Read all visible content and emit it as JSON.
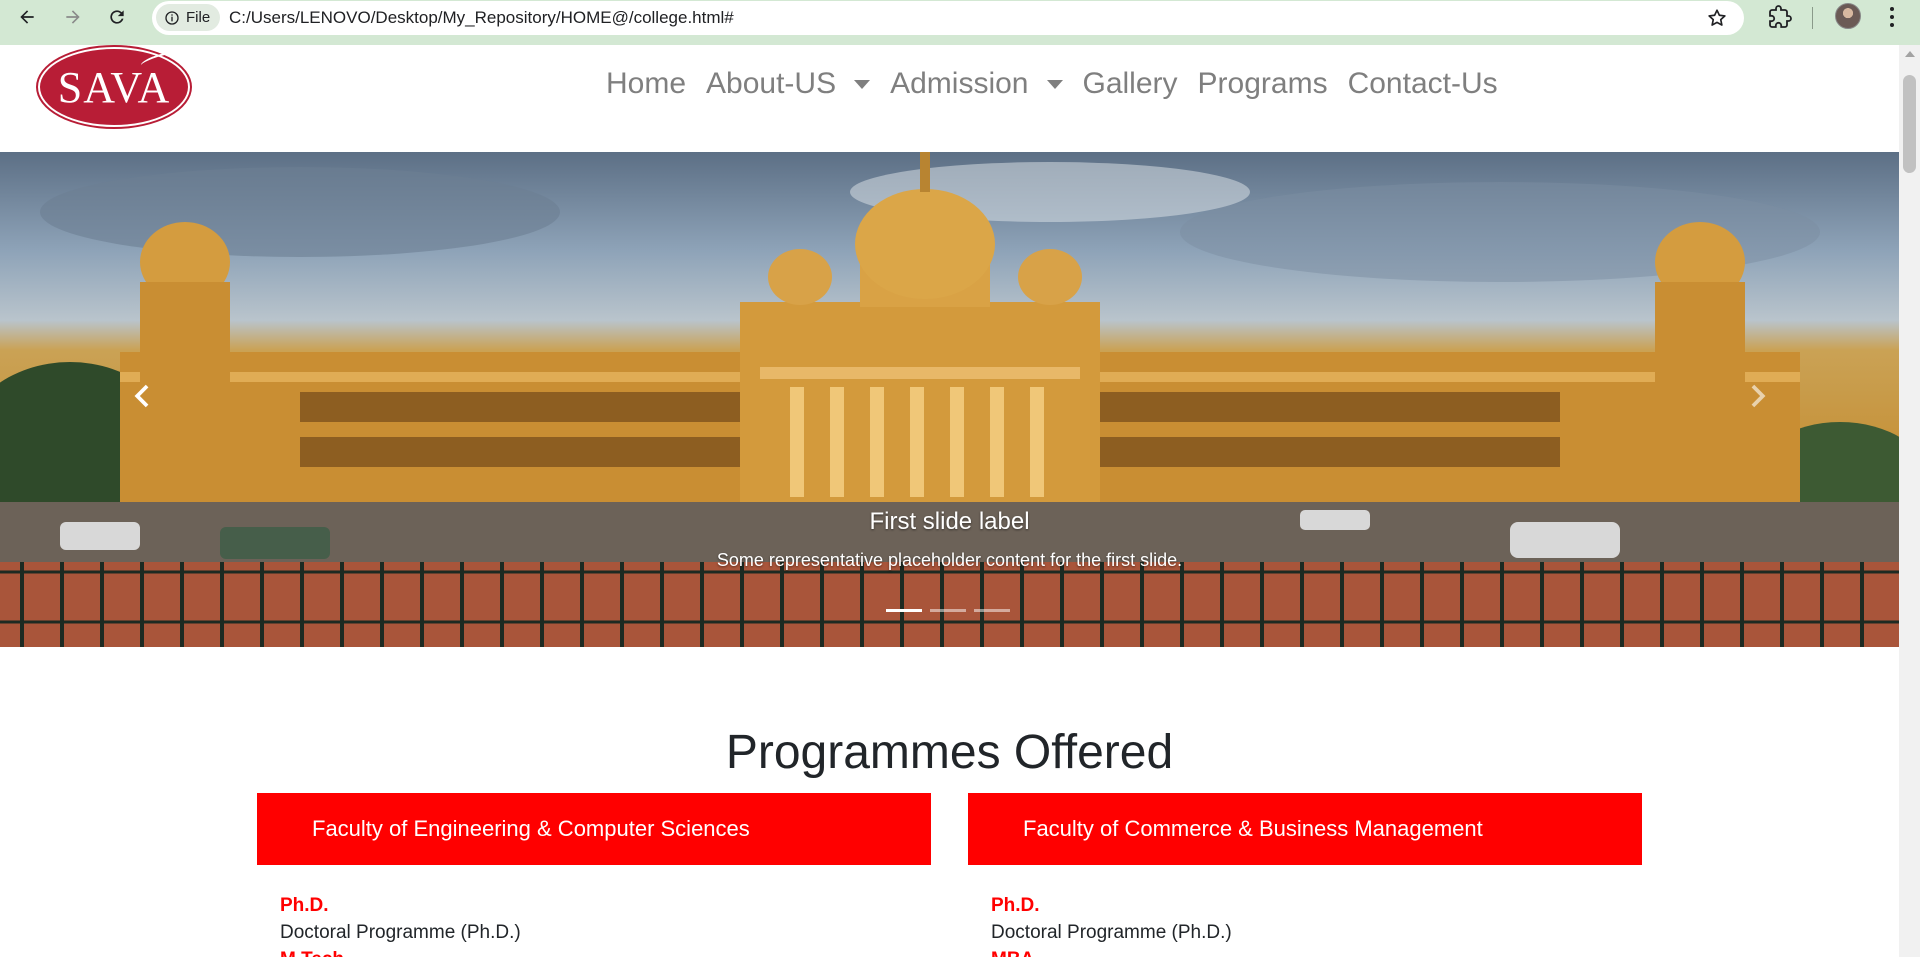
{
  "browser": {
    "site_chip": "File",
    "url": "C:/Users/LENOVO/Desktop/My_Repository/HOME@/college.html#"
  },
  "logo": {
    "text": "SAVA"
  },
  "nav": {
    "items": [
      {
        "label": "Home"
      },
      {
        "label": "About-US",
        "dropdown": true
      },
      {
        "label": "Admission",
        "dropdown": true
      },
      {
        "label": "Gallery"
      },
      {
        "label": "Programs"
      },
      {
        "label": "Contact-Us"
      }
    ]
  },
  "carousel": {
    "slide_title": "First slide label",
    "slide_text": "Some representative placeholder content for the first slide.",
    "slide_count": 3,
    "active_slide": 1
  },
  "programmes": {
    "title": "Programmes Offered",
    "faculties": [
      {
        "name": "Faculty of Engineering & Computer Sciences",
        "items": [
          {
            "level": "Ph.D.",
            "name": "Doctoral Programme (Ph.D.)"
          },
          {
            "level": "M.Tech"
          }
        ]
      },
      {
        "name": "Faculty of Commerce & Business Management",
        "items": [
          {
            "level": "Ph.D.",
            "name": "Doctoral Programme (Ph.D.)"
          },
          {
            "level": "MBA"
          }
        ]
      }
    ]
  },
  "colors": {
    "faculty_header": "#ff0000",
    "program_level": "#ff0000",
    "nav_text": "#7f7f7f",
    "logo_bg": "#b81d36",
    "chrome_bg": "#d3e8d3"
  }
}
